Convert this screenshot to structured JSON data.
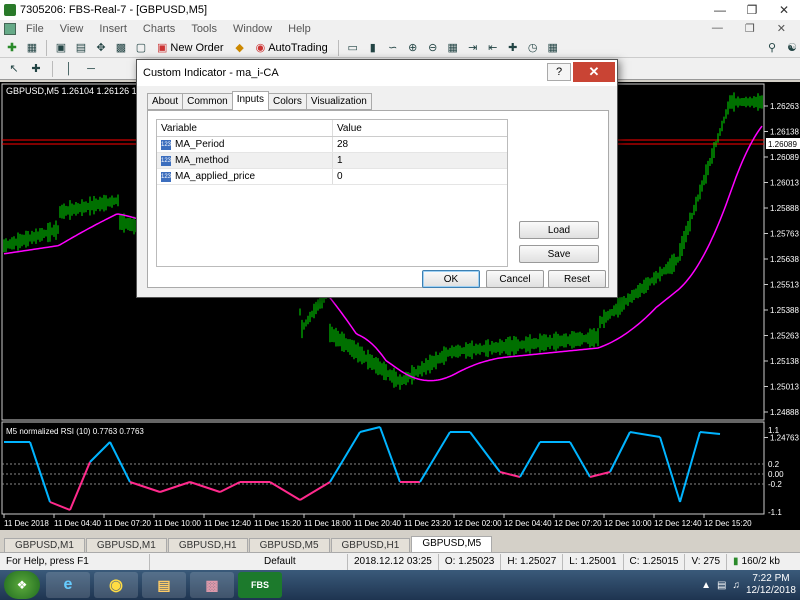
{
  "window": {
    "title": "7305206: FBS-Real-7 - [GBPUSD,M5]"
  },
  "menu": [
    "File",
    "View",
    "Insert",
    "Charts",
    "Tools",
    "Window",
    "Help"
  ],
  "toolbar": {
    "new_order": "New Order",
    "autotrading": "AutoTrading"
  },
  "chart": {
    "header": "GBPUSD,M5  1.26104 1.26126 1.26083 1.26089",
    "price_labels": [
      "1.26263",
      "1.26138",
      "1.26089",
      "1.26013",
      "1.25888",
      "1.25763",
      "1.25638",
      "1.25513",
      "1.25388",
      "1.25263",
      "1.25138",
      "1.25013",
      "1.24888",
      "1.24763"
    ],
    "current_price": "1.26089",
    "indicator_label": "M5 normalized RSI (10) 0.7763 0.7763",
    "indicator_levels": [
      "1.1",
      "0.2",
      "0.00",
      "-0.2",
      "-1.1"
    ],
    "time_labels": [
      "11 Dec 2018",
      "11 Dec 04:40",
      "11 Dec 07:20",
      "11 Dec 10:00",
      "11 Dec 12:40",
      "11 Dec 15:20",
      "11 Dec 18:00",
      "11 Dec 20:40",
      "11 Dec 23:20",
      "12 Dec 02:00",
      "12 Dec 04:40",
      "12 Dec 07:20",
      "12 Dec 10:00",
      "12 Dec 12:40",
      "12 Dec 15:20"
    ],
    "colors": {
      "candles": "#00e000",
      "ma": "#ff00ff",
      "rsi_up": "#00b4ff",
      "rsi_down": "#ff2a8c",
      "price_line": "#ff0000"
    }
  },
  "tabs": [
    "GBPUSD,M1",
    "GBPUSD,M1",
    "GBPUSD,H1",
    "GBPUSD,M5",
    "GBPUSD,H1",
    "GBPUSD,M5"
  ],
  "status": {
    "help": "For Help, press F1",
    "profile": "Default",
    "datetime": "2018.12.12 03:25",
    "open": "O: 1.25023",
    "high": "H: 1.25027",
    "low": "L: 1.25001",
    "close": "C: 1.25015",
    "volume": "V: 275",
    "traffic": "160/2 kb"
  },
  "taskbar": {
    "app_label": "FBS",
    "time": "7:22 PM",
    "date": "12/12/2018"
  },
  "dialog": {
    "title": "Custom Indicator - ma_i-CA",
    "tabs": [
      "About",
      "Common",
      "Inputs",
      "Colors",
      "Visualization"
    ],
    "columns": [
      "Variable",
      "Value"
    ],
    "rows": [
      {
        "name": "MA_Period",
        "value": "28"
      },
      {
        "name": "MA_method",
        "value": "1"
      },
      {
        "name": "MA_applied_price",
        "value": "0"
      }
    ],
    "buttons": {
      "load": "Load",
      "save": "Save",
      "ok": "OK",
      "cancel": "Cancel",
      "reset": "Reset"
    }
  }
}
